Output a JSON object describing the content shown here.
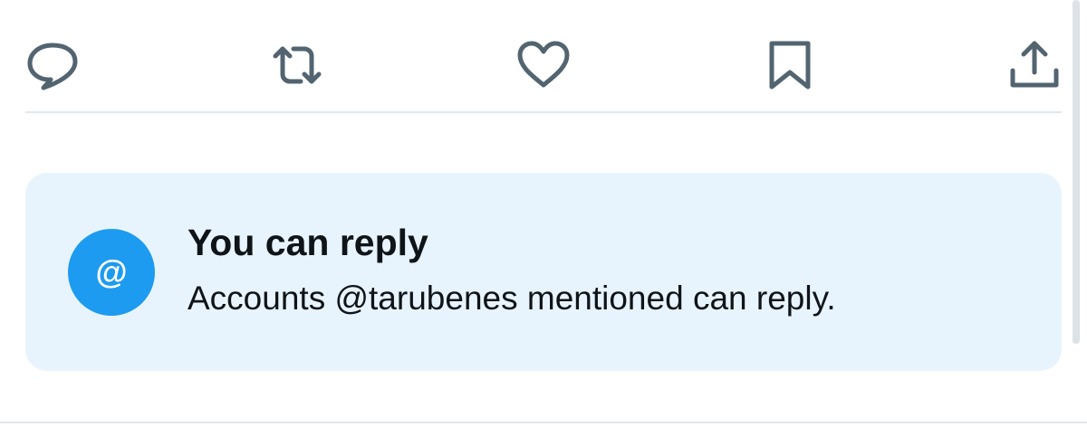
{
  "actions": [
    {
      "name": "reply",
      "icon": "comment-icon"
    },
    {
      "name": "retweet",
      "icon": "retweet-icon"
    },
    {
      "name": "like",
      "icon": "heart-icon"
    },
    {
      "name": "bookmark",
      "icon": "bookmark-icon"
    },
    {
      "name": "share",
      "icon": "share-icon"
    }
  ],
  "reply_notice": {
    "icon": "at-sign-icon",
    "icon_glyph": "@",
    "title": "You can reply",
    "subtitle": "Accounts @tarubenes mentioned can reply."
  },
  "colors": {
    "icon": "#536471",
    "accent": "#1d9bf0",
    "card_background": "#e8f4fd",
    "text": "#0f1419"
  }
}
